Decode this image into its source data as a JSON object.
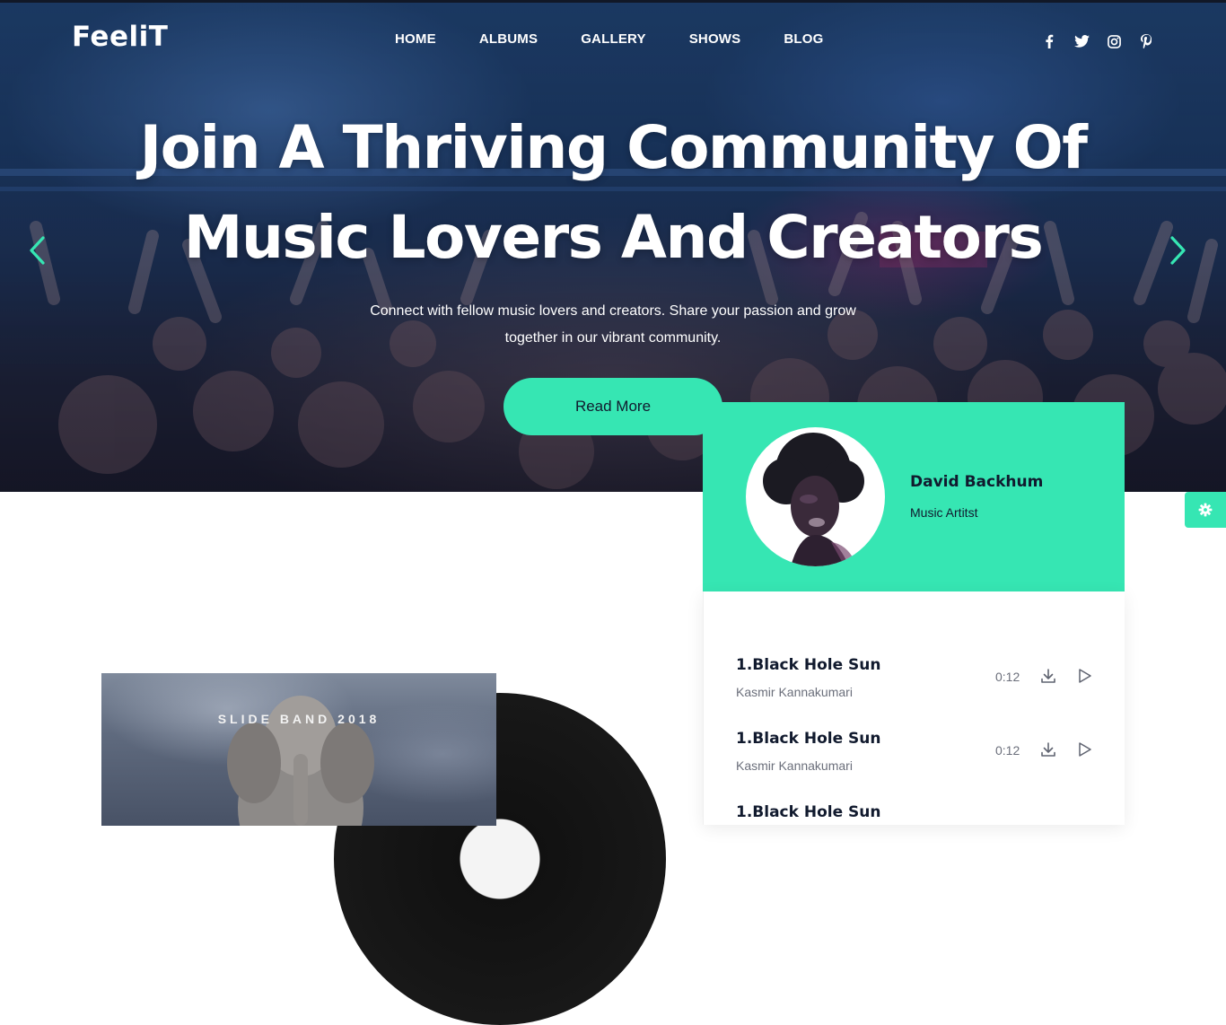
{
  "brand": {
    "logo_text": "FeeliT"
  },
  "nav": {
    "items": [
      {
        "label": "HOME"
      },
      {
        "label": "ALBUMS"
      },
      {
        "label": "GALLERY"
      },
      {
        "label": "SHOWS"
      },
      {
        "label": "BLOG"
      }
    ]
  },
  "social": {
    "icons": [
      "facebook-icon",
      "twitter-icon",
      "instagram-icon",
      "pinterest-icon"
    ]
  },
  "hero": {
    "title_line1": "Join A Thriving Community Of",
    "title_line2": "Music Lovers And Creators",
    "subtitle_line1": "Connect with fellow music lovers and creators. Share your passion and grow",
    "subtitle_line2": "together in our vibrant community.",
    "cta_label": "Read More"
  },
  "profile": {
    "name": "David Backhum",
    "role": "Music Artitst"
  },
  "tracks": [
    {
      "title": "1.Black Hole Sun",
      "artist": "Kasmir Kannakumari",
      "duration": "0:12"
    },
    {
      "title": "1.Black Hole Sun",
      "artist": "Kasmir Kannakumari",
      "duration": "0:12"
    },
    {
      "title": "1.Black Hole Sun",
      "artist": "",
      "duration": ""
    }
  ],
  "album": {
    "cover_text": "SLIDE BAND 2018"
  },
  "colors": {
    "accent": "#36e6b3",
    "dark_text": "#111a2e",
    "muted_text": "#6b6f7b"
  }
}
